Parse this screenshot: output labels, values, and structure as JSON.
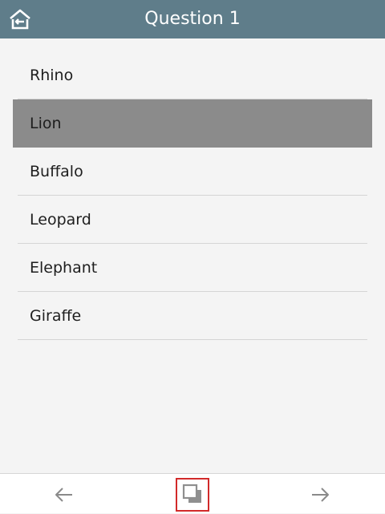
{
  "header": {
    "title": "Question 1",
    "home_icon": "home-back-icon"
  },
  "options": [
    {
      "label": "Rhino",
      "selected": false
    },
    {
      "label": "Lion",
      "selected": true
    },
    {
      "label": "Buffalo",
      "selected": false
    },
    {
      "label": "Leopard",
      "selected": false
    },
    {
      "label": "Elephant",
      "selected": false
    },
    {
      "label": "Giraffe",
      "selected": false
    }
  ],
  "footer": {
    "prev_icon": "arrow-left-icon",
    "center_icon": "overlap-squares-icon",
    "next_icon": "arrow-right-icon"
  },
  "colors": {
    "header_bg": "#5f7d8a",
    "selected_bg": "#8b8b8b",
    "page_bg": "#f4f4f4",
    "center_button_border": "#d22a2a"
  }
}
